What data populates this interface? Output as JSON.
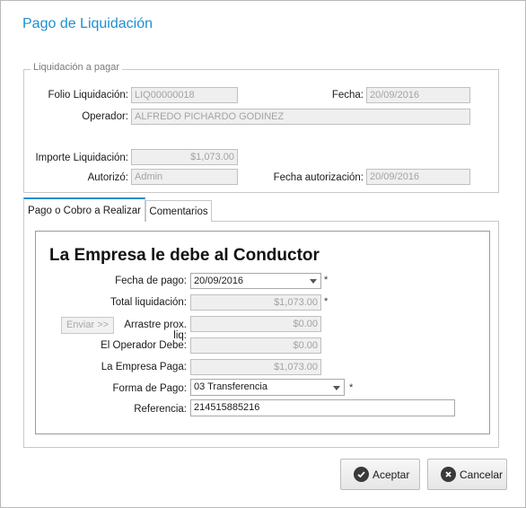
{
  "window": {
    "title": "Pago de Liquidación"
  },
  "liquidacion": {
    "legend": "Liquidación a pagar",
    "folio_label": "Folio Liquidación:",
    "folio_value": "LIQ00000018",
    "fecha_label": "Fecha:",
    "fecha_value": "20/09/2016",
    "operador_label": "Operador:",
    "operador_value": "ALFREDO PICHARDO GODINEZ",
    "importe_label": "Importe Liquidación:",
    "importe_value": "$1,073.00",
    "autorizo_label": "Autorizó:",
    "autorizo_value": "Admin",
    "fecha_aut_label": "Fecha autorización:",
    "fecha_aut_value": "20/09/2016"
  },
  "tabs": [
    {
      "label": "Pago o Cobro a Realizar",
      "selected": true
    },
    {
      "label": "Comentarios",
      "selected": false
    }
  ],
  "pago": {
    "heading": "La Empresa le debe al Conductor",
    "fecha_pago_label": "Fecha de pago:",
    "fecha_pago_value": "20/09/2016",
    "total_label": "Total liquidación:",
    "total_value": "$1,073.00",
    "enviar_label": "Enviar >>",
    "arrastre_label": "Arrastre prox. liq:",
    "arrastre_value": "$0.00",
    "operador_debe_label": "El Operador Debe:",
    "operador_debe_value": "$0.00",
    "empresa_paga_label": "La Empresa Paga:",
    "empresa_paga_value": "$1,073.00",
    "forma_pago_label": "Forma de Pago:",
    "forma_pago_value": "03 Transferencia",
    "referencia_label": "Referencia:",
    "referencia_value": "214515885216",
    "required_mark": "*"
  },
  "footer": {
    "aceptar_label": "Aceptar",
    "cancelar_label": "Cancelar",
    "aceptar_icon": "check-circle-icon",
    "cancelar_icon": "x-circle-icon"
  },
  "colors": {
    "accent": "#1e8fd0",
    "disabled_bg": "#efefef",
    "disabled_text": "#a3a3a3"
  }
}
